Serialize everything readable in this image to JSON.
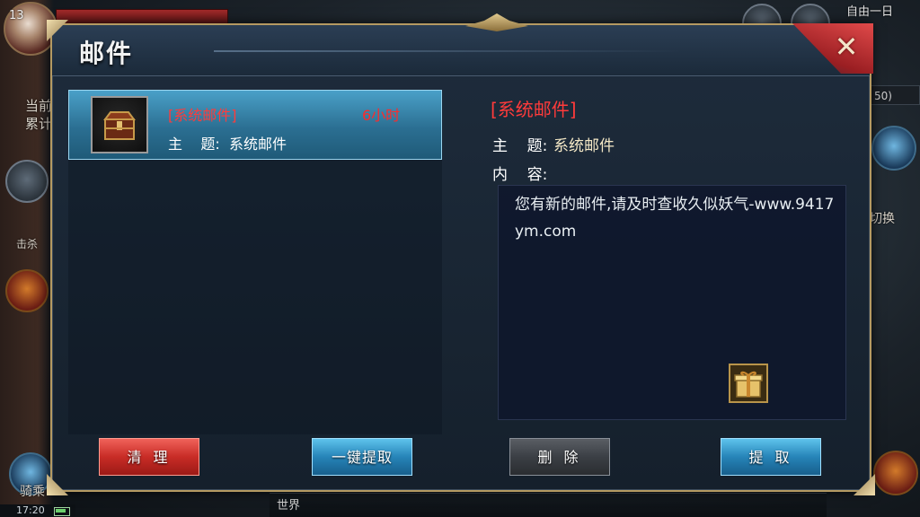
{
  "hud": {
    "level": "13",
    "left_text_1": "当前",
    "left_text_2": "累计",
    "left_kill": "击杀",
    "mount_label": "骑乘",
    "top_right": "自由一日",
    "right_strip": "50)",
    "switch_label": "切换",
    "clock": "17:20",
    "chat_world": "世界"
  },
  "dialog": {
    "title": "邮件",
    "close_icon": "close-icon"
  },
  "mail_list": {
    "items": [
      {
        "title": "[系统邮件]",
        "time": "6小时",
        "subject_label": "主    题:",
        "subject": "系统邮件",
        "icon": "treasure-chest-icon"
      }
    ]
  },
  "detail": {
    "title": "[系统邮件]",
    "subject_label": "主    题:",
    "subject": "系统邮件",
    "content_label": "内    容:",
    "content": "您有新的邮件,请及时查收久似妖气-www.9417ym.com",
    "attachment_icon": "gift-box-icon"
  },
  "buttons": {
    "clean": "清 理",
    "onekey": "一键提取",
    "delete": "删 除",
    "take": "提 取"
  },
  "colors": {
    "accent_red": "#ff3b3b",
    "selected_blue": "#2b6f92",
    "frame_gold": "#b59a62"
  }
}
